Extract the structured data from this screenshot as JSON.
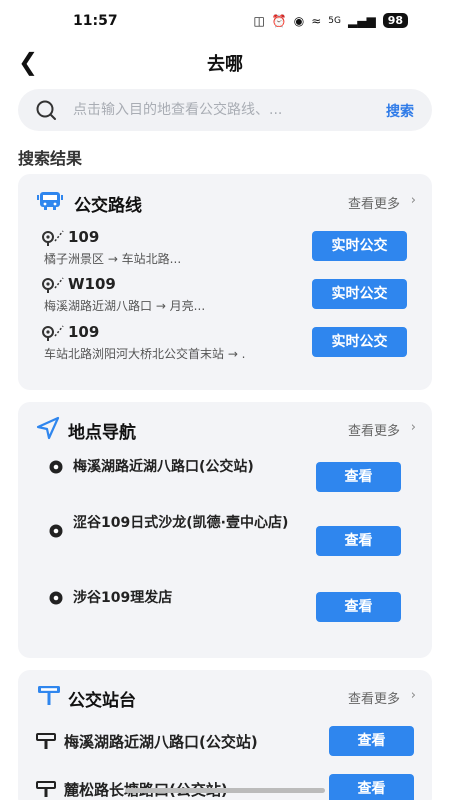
{
  "status_bar": {
    "time": "11:57",
    "network": "5G",
    "battery": "98"
  },
  "header": {
    "title": "去哪"
  },
  "search": {
    "placeholder": "点击输入目的地查看公交路线、...",
    "button_label": "搜索"
  },
  "results_heading": "搜索结果",
  "bus_routes": {
    "title": "公交路线",
    "more_label": "查看更多",
    "items": [
      {
        "name": "109",
        "desc": "橘子洲景区 → 车站北路...",
        "button": "实时公交"
      },
      {
        "name": "W109",
        "desc": "梅溪湖路近湖八路口 → 月亮...",
        "button": "实时公交"
      },
      {
        "name": "109",
        "desc": "车站北路浏阳河大桥北公交首末站 → .",
        "button": "实时公交"
      }
    ]
  },
  "place_nav": {
    "title": "地点导航",
    "more_label": "查看更多",
    "items": [
      {
        "name": "梅溪湖路近湖八路口(公交站)",
        "button": "查看"
      },
      {
        "name": "涩谷109日式沙龙(凯德·壹中心店)",
        "button": "查看"
      },
      {
        "name": "涉谷109理发店",
        "button": "查看"
      }
    ]
  },
  "bus_stops": {
    "title": "公交站台",
    "more_label": "查看更多",
    "items": [
      {
        "name": "梅溪湖路近湖八路口(公交站)",
        "button": "查看"
      },
      {
        "name": "麓松路长塘路口(公交站)",
        "button": "查看"
      }
    ]
  },
  "colors": {
    "accent": "#2f86ee",
    "card_bg": "#f3f4f7",
    "link": "#2f7be8"
  }
}
